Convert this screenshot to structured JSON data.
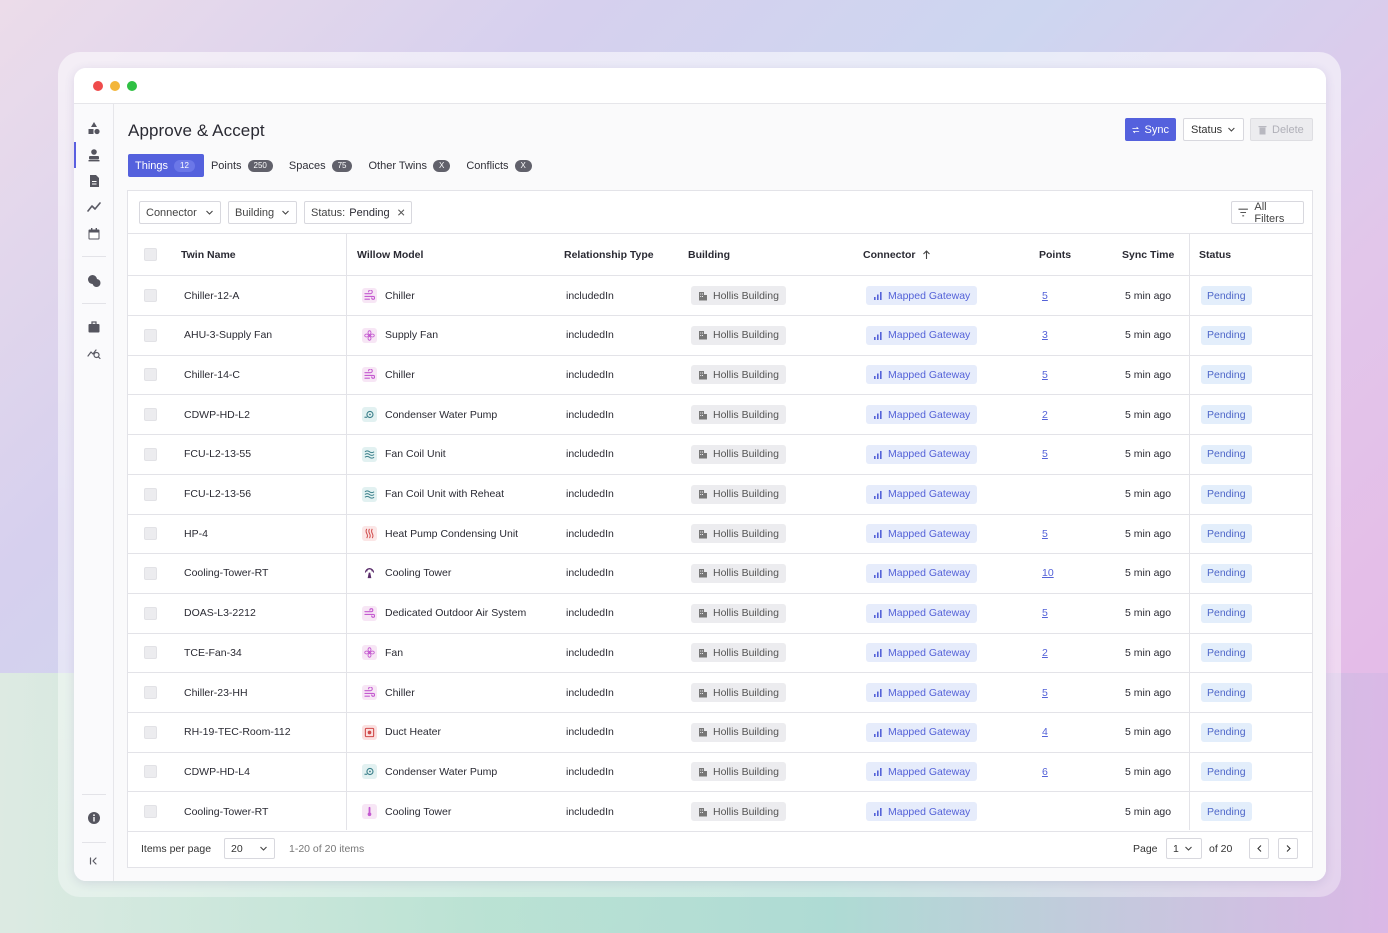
{
  "page": {
    "title": "Approve & Accept",
    "actions": {
      "sync": "Sync",
      "status": "Status",
      "delete": "Delete"
    }
  },
  "tabs": [
    {
      "label": "Things",
      "count": "12",
      "active": true
    },
    {
      "label": "Points",
      "count": "250",
      "active": false
    },
    {
      "label": "Spaces",
      "count": "75",
      "active": false
    },
    {
      "label": "Other Twins",
      "count": "X",
      "active": false
    },
    {
      "label": "Conflicts",
      "count": "X",
      "active": false
    }
  ],
  "filters": {
    "connector": "Connector",
    "building": "Building",
    "status_prefix": "Status:",
    "status_value": "Pending",
    "all_filters": "All Filters"
  },
  "columns": {
    "twin_name": "Twin Name",
    "model": "Willow Model",
    "relationship": "Relationship Type",
    "building": "Building",
    "connector": "Connector",
    "points": "Points",
    "sync_time": "Sync Time",
    "status": "Status"
  },
  "rows": [
    {
      "name": "Chiller-12-A",
      "model": "Chiller",
      "model_icon": "chiller-icon",
      "relationship": "includedIn",
      "building": "Hollis Building",
      "connector": "Mapped Gateway",
      "points": "5",
      "sync": "5 min ago",
      "status": "Pending"
    },
    {
      "name": "AHU-3-Supply Fan",
      "model": "Supply Fan",
      "model_icon": "fan-icon",
      "relationship": "includedIn",
      "building": "Hollis Building",
      "connector": "Mapped Gateway",
      "points": "3",
      "sync": "5 min ago",
      "status": "Pending"
    },
    {
      "name": "Chiller-14-C",
      "model": "Chiller",
      "model_icon": "chiller-icon",
      "relationship": "includedIn",
      "building": "Hollis Building",
      "connector": "Mapped Gateway",
      "points": "5",
      "sync": "5 min ago",
      "status": "Pending"
    },
    {
      "name": "CDWP-HD-L2",
      "model": "Condenser Water Pump",
      "model_icon": "pump-icon",
      "relationship": "includedIn",
      "building": "Hollis Building",
      "connector": "Mapped Gateway",
      "points": "2",
      "sync": "5 min ago",
      "status": "Pending"
    },
    {
      "name": "FCU-L2-13-55",
      "model": "Fan Coil Unit",
      "model_icon": "coil-icon",
      "relationship": "includedIn",
      "building": "Hollis Building",
      "connector": "Mapped Gateway",
      "points": "5",
      "sync": "5 min ago",
      "status": "Pending"
    },
    {
      "name": "FCU-L2-13-56",
      "model": "Fan Coil Unit with Reheat",
      "model_icon": "coil-icon",
      "relationship": "includedIn",
      "building": "Hollis Building",
      "connector": "Mapped Gateway",
      "points": "",
      "sync": "5 min ago",
      "status": "Pending"
    },
    {
      "name": "HP-4",
      "model": "Heat Pump Condensing Unit",
      "model_icon": "heat-icon",
      "relationship": "includedIn",
      "building": "Hollis Building",
      "connector": "Mapped Gateway",
      "points": "5",
      "sync": "5 min ago",
      "status": "Pending"
    },
    {
      "name": "Cooling-Tower-RT",
      "model": "Cooling Tower",
      "model_icon": "tower-icon",
      "relationship": "includedIn",
      "building": "Hollis Building",
      "connector": "Mapped Gateway",
      "points": "10",
      "sync": "5 min ago",
      "status": "Pending"
    },
    {
      "name": "DOAS-L3-2212",
      "model": "Dedicated Outdoor Air System",
      "model_icon": "air-icon",
      "relationship": "includedIn",
      "building": "Hollis Building",
      "connector": "Mapped Gateway",
      "points": "5",
      "sync": "5 min ago",
      "status": "Pending"
    },
    {
      "name": "TCE-Fan-34",
      "model": "Fan",
      "model_icon": "fan-icon",
      "relationship": "includedIn",
      "building": "Hollis Building",
      "connector": "Mapped Gateway",
      "points": "2",
      "sync": "5 min ago",
      "status": "Pending"
    },
    {
      "name": "Chiller-23-HH",
      "model": "Chiller",
      "model_icon": "chiller-icon",
      "relationship": "includedIn",
      "building": "Hollis Building",
      "connector": "Mapped Gateway",
      "points": "5",
      "sync": "5 min ago",
      "status": "Pending"
    },
    {
      "name": "RH-19-TEC-Room-112",
      "model": "Duct Heater",
      "model_icon": "heater-icon",
      "relationship": "includedIn",
      "building": "Hollis Building",
      "connector": "Mapped Gateway",
      "points": "4",
      "sync": "5 min ago",
      "status": "Pending"
    },
    {
      "name": "CDWP-HD-L4",
      "model": "Condenser Water Pump",
      "model_icon": "pump-icon",
      "relationship": "includedIn",
      "building": "Hollis Building",
      "connector": "Mapped Gateway",
      "points": "6",
      "sync": "5 min ago",
      "status": "Pending"
    },
    {
      "name": "Cooling-Tower-RT",
      "model": "Cooling Tower",
      "model_icon": "thermometer-icon",
      "relationship": "includedIn",
      "building": "Hollis Building",
      "connector": "Mapped Gateway",
      "points": "",
      "sync": "5 min ago",
      "status": "Pending"
    }
  ],
  "footer": {
    "items_per_page_label": "Items per page",
    "items_per_page": "20",
    "range": "1-20 of 20 items",
    "page_label": "Page",
    "page": "1",
    "of_pages": "of 20"
  },
  "colors": {
    "accent": "#5461dd",
    "pending_bg": "#e3eefb",
    "gateway_text": "#5462d8",
    "model_icon_bg": "#f7e6f5"
  }
}
